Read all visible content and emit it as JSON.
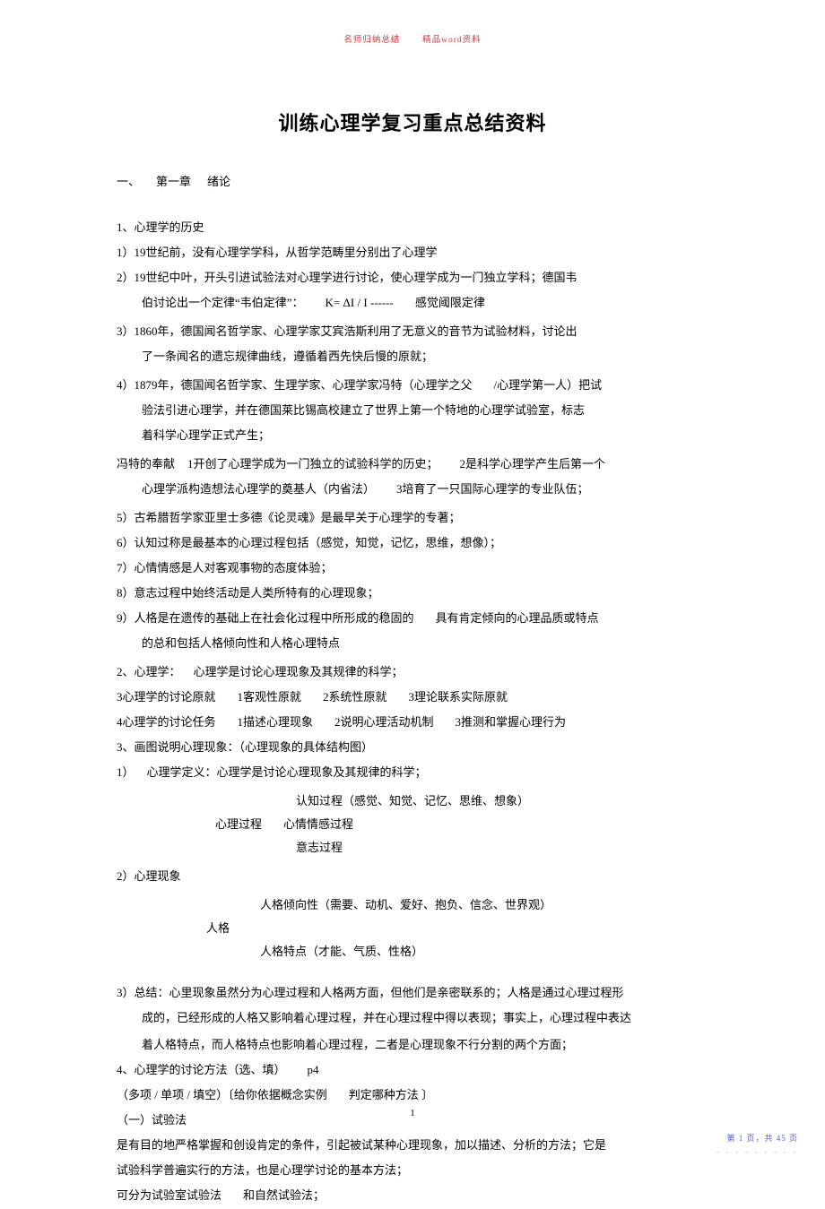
{
  "header": {
    "left": "名师归纳总结",
    "right": "精品word资料"
  },
  "title": "训练心理学复习重点总结资料",
  "chapter1": {
    "prefix": "一、",
    "mid": "第一章",
    "suffix": "绪论"
  },
  "p1": "1、心理学的历史",
  "p2": "1）19世纪前，没有心理学学科，从哲学范畴里分别出了心理学",
  "p3a": "2）19世纪中叶，开头引进试验法对心理学进行讨论，使心理学成为一门独立学科；德国韦",
  "p3b": "伯讨论出一个定律“韦伯定律”：",
  "p3c": "K= ΔI / I   ------",
  "p3d": "感觉阈限定律",
  "p4a": "3）1860年，德国闻名哲学家、心理学家艾宾浩斯利用了无意义的音节为试验材料，讨论出",
  "p4b": "了一条闻名的遗忘规律曲线，遵循着西先快后慢的原就；",
  "p5a": "4）1879年，德国闻名哲学家、生理学家、心理学家冯特（心理学之父",
  "p5b": "/心理学第一人）把试",
  "p5c": "验法引进心理学，并在德国莱比锡高校建立了世界上第一个特地的心理学试验室，标志",
  "p5d": "着科学心理学正式产生；",
  "p6a": "冯特的奉献",
  "p6b": "1开创了心理学成为一门独立的试验科学的历史；",
  "p6c": "2是科学心理学产生后第一个",
  "p6d": "心理学派构造想法心理学的奠基人（内省法）",
  "p6e": "3培育了一只国际心理学的专业队伍；",
  "p7": "5）古希腊哲学家亚里士多德《论灵魂》是最早关于心理学的专著；",
  "p8": "6）认知过称是最基本的心理过程包括（感觉，知觉，记忆，思维，想像）；",
  "p9": "7）心情情感是人对客观事物的态度体验；",
  "p10": "8）意志过程中始终活动是人类所特有的心理现象；",
  "p11a": "9）人格是在遗传的基础上在社会化过程中所形成的稳固的",
  "p11b": "具有肯定倾向的心理品质或特点",
  "p11c": "的总和包括人格倾向性和人格心理特点",
  "p12a": "2、心理学：",
  "p12b": "心理学是讨论心理现象及其规律的科学；",
  "p13a": "3心理学的讨论原就",
  "p13b": "1客观性原就",
  "p13c": "2系统性原就",
  "p13d": "3理论联系实际原就",
  "p14a": "4心理学的讨论任务",
  "p14b": "1描述心理现象",
  "p14c": "2说明心理活动机制",
  "p14d": "3推测和掌握心理行为",
  "p15": "3、画图说明心理现象：（心理现象的具体结构图）",
  "p16a": "1）",
  "p16b": "心理学定义：心理学是讨论心理现象及其规律的科学；",
  "tree1": "认知过程（感觉、知觉、记忆、思维、想象）",
  "tree2a": "心理过程",
  "tree2b": "心情情感过程",
  "tree3": "意志过程",
  "p17": "2）心理现象",
  "tree4": "人格倾向性（需要、动机、爱好、抱负、信念、世界观）",
  "tree5": "人格",
  "tree6": "人格特点（才能、气质、性格）",
  "p18a": "3）总结：心里现象虽然分为心理过程和人格两方面，但他们是亲密联系的；人格是通过心理过程形",
  "p18b": "成的，已经形成的人格又影响着心理过程，并在心理过程中得以表现；事实上，心理过程中表达",
  "p18c": "着人格特点，而人格特点也影响着心理过程，二者是心理现象不行分割的两个方面；",
  "p19a": "4、心理学的讨论方法（选、填）",
  "p19b": "p4",
  "p20a": "（多项 / 单项 / 填空）〔给你依据概念实例",
  "p20b": "判定哪种方法  〕",
  "p21": "（一）试验法",
  "p22a": "是有目的地严格掌握和创设肯定的条件，引起被试某种心理现象，加以描述、分析的方法；它是",
  "p22b": "试验科学普遍实行的方法，也是心理学讨论的基本方法；",
  "p23a": "可分为试验室试验法",
  "p23b": "和自然试验法；",
  "pagenum_center": "1",
  "pagenum_corner": "第 1 页，共 45 页",
  "dashline": "- - - - - - - - -"
}
